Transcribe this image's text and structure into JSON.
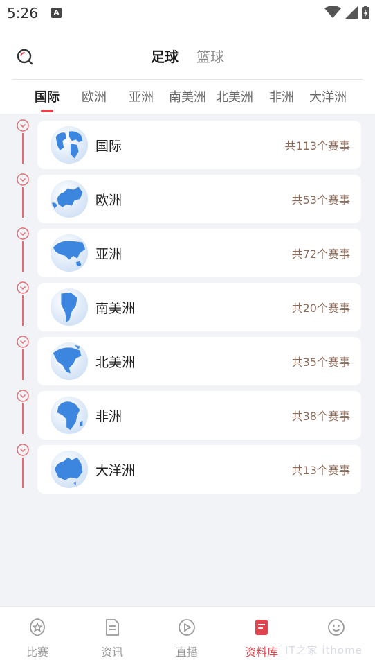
{
  "status_bar": {
    "time": "5:26",
    "notification_icon": "A"
  },
  "header": {
    "sport_tabs": [
      {
        "label": "足球",
        "active": true
      },
      {
        "label": "篮球",
        "active": false
      }
    ],
    "region_tabs": [
      {
        "label": "国际",
        "active": true
      },
      {
        "label": "欧洲"
      },
      {
        "label": "亚洲"
      },
      {
        "label": "南美洲"
      },
      {
        "label": "北美洲"
      },
      {
        "label": "非洲"
      },
      {
        "label": "大洋洲"
      }
    ]
  },
  "regions": [
    {
      "name": "国际",
      "count": "共113个赛事",
      "icon": "world-globe-icon"
    },
    {
      "name": "欧洲",
      "count": "共53个赛事",
      "icon": "europe-globe-icon"
    },
    {
      "name": "亚洲",
      "count": "共72个赛事",
      "icon": "asia-globe-icon"
    },
    {
      "name": "南美洲",
      "count": "共20个赛事",
      "icon": "south-america-globe-icon"
    },
    {
      "name": "北美洲",
      "count": "共35个赛事",
      "icon": "north-america-globe-icon"
    },
    {
      "name": "非洲",
      "count": "共38个赛事",
      "icon": "africa-globe-icon"
    },
    {
      "name": "大洋洲",
      "count": "共13个赛事",
      "icon": "oceania-globe-icon"
    }
  ],
  "tab_bar": {
    "items": [
      {
        "label": "比赛",
        "icon": "star-badge-icon"
      },
      {
        "label": "资讯",
        "icon": "document-icon"
      },
      {
        "label": "直播",
        "icon": "play-circle-icon"
      },
      {
        "label": "资料库",
        "icon": "database-book-icon",
        "active": true
      },
      {
        "label": "",
        "icon": "smiley-icon"
      }
    ],
    "watermark": "IT之家 ithome"
  },
  "colors": {
    "accent": "#e0454f",
    "count_text": "#8a6a58",
    "background": "#f2f3f7"
  }
}
